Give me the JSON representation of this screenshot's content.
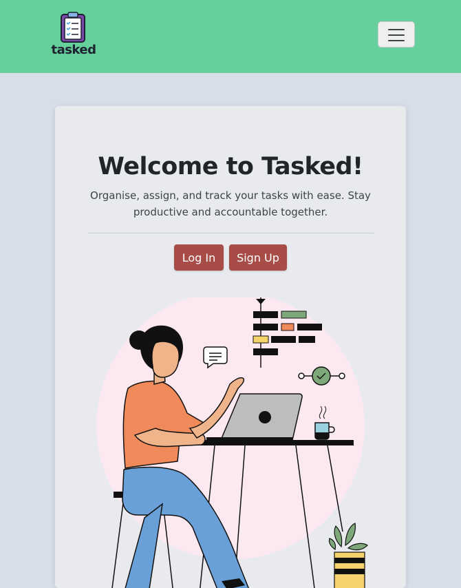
{
  "brand": {
    "name": "tasked"
  },
  "nav": {
    "toggler_icon": "hamburger-menu-icon"
  },
  "hero": {
    "title": "Welcome to Tasked!",
    "lead": "Organise, assign, and track your tasks with ease. Stay productive and accountable together.",
    "login_label": "Log In",
    "signup_label": "Sign Up"
  },
  "colors": {
    "navbar": "#66d09c",
    "page_background": "#d8dee8",
    "card": "#e8eaed",
    "button": "#a84c48",
    "illustration_circle": "#fbe8f0"
  }
}
